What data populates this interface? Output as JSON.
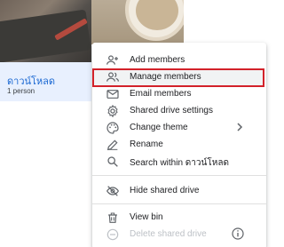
{
  "drive_card": {
    "name": "ดาวน์โหลด",
    "meta": "1 person"
  },
  "menu": {
    "items": [
      {
        "label": "Add members",
        "icon": "add-person-icon"
      },
      {
        "label": "Manage members",
        "icon": "people-icon"
      },
      {
        "label": "Email members",
        "icon": "mail-icon"
      },
      {
        "label": "Shared drive settings",
        "icon": "gear-icon"
      },
      {
        "label": "Change theme",
        "icon": "palette-icon"
      },
      {
        "label": "Rename",
        "icon": "pencil-icon"
      },
      {
        "label": "Search within ดาวน์โหลด",
        "icon": "search-icon"
      },
      {
        "label": "Hide shared drive",
        "icon": "eye-off-icon"
      },
      {
        "label": "View bin",
        "icon": "trash-icon"
      },
      {
        "label": "Delete shared drive",
        "icon": "remove-circle-icon",
        "disabled": true
      }
    ],
    "highlighted_item": "Manage members"
  },
  "colors": {
    "highlight_border": "#d3222a",
    "link_blue": "#1967d2",
    "selected_bg": "#e8f0fe"
  }
}
